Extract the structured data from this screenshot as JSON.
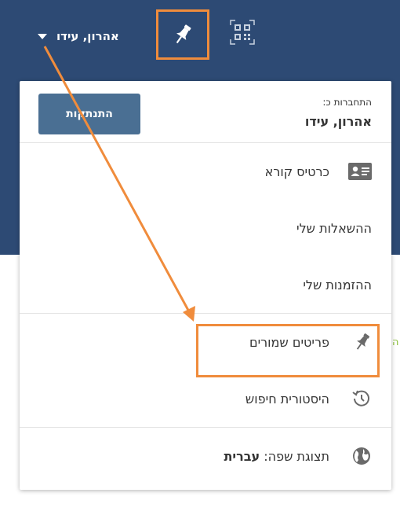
{
  "header": {
    "user_name": "אהרון, עידו",
    "icons": {
      "dropdown": "caret-down-icon",
      "pin": "pushpin-icon",
      "qr": "qr-code-icon"
    }
  },
  "menu": {
    "login_label": "התחברות כ:",
    "login_name": "אהרון, עידו",
    "logout_label": "התנתקות",
    "items": [
      {
        "label": "כרטיס קורא",
        "icon": "id-card-icon"
      },
      {
        "label": "ההשאלות שלי"
      },
      {
        "label": "ההזמנות שלי"
      },
      {
        "label": "פריטים שמורים",
        "icon": "pushpin-icon"
      },
      {
        "label": "היסטורית חיפוש",
        "icon": "history-icon"
      },
      {
        "label_prefix": "תצוגת שפה:",
        "label_value": "עברית",
        "icon": "globe-icon"
      }
    ]
  },
  "edge_text": "ה",
  "colors": {
    "header_bg": "#2d4a74",
    "highlight": "#f08c3c",
    "button_bg": "#4a6f93"
  }
}
